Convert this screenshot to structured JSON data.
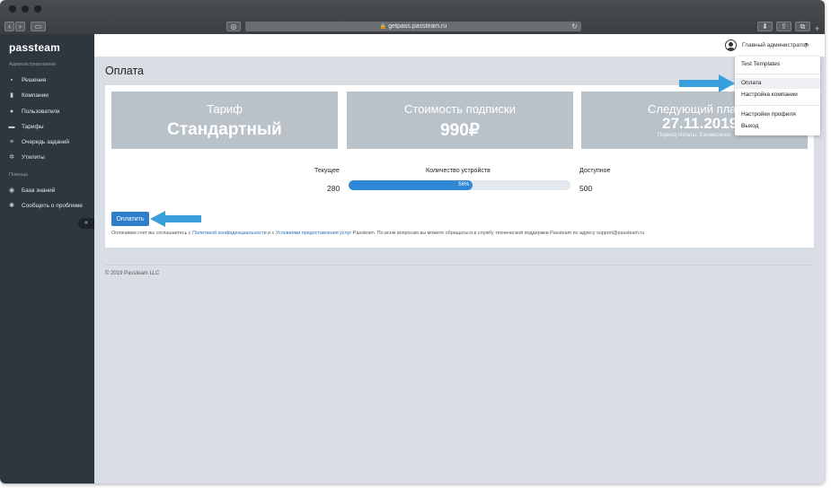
{
  "browser": {
    "url": "getpass.passteam.ru"
  },
  "sidebar": {
    "logo": "passteam",
    "admin_heading": "Администрирование",
    "items": [
      {
        "label": "Решения",
        "icon": "briefcase-icon"
      },
      {
        "label": "Компании",
        "icon": "building-icon"
      },
      {
        "label": "Пользователи",
        "icon": "users-icon"
      },
      {
        "label": "Тарифы",
        "icon": "card-icon"
      },
      {
        "label": "Очередь заданий",
        "icon": "list-icon"
      },
      {
        "label": "Утилиты",
        "icon": "gear-icon"
      }
    ],
    "help_heading": "Помощь",
    "help_items": [
      {
        "label": "База знаний",
        "icon": "lifebuoy-icon"
      },
      {
        "label": "Сообщить о проблеме",
        "icon": "bug-icon"
      }
    ],
    "collapse_label": "«"
  },
  "header": {
    "user_name": "Главный администратор"
  },
  "dropdown": {
    "items": [
      "Test Templates",
      "Оплата",
      "Настройка компании",
      "Настройки профиля",
      "Выход"
    ],
    "active": "Оплата"
  },
  "main": {
    "title": "Оплата",
    "tiles": {
      "plan": {
        "title": "Тариф",
        "value": "Стандартный"
      },
      "subscription": {
        "title": "Стоимость подписки",
        "value": "990₽"
      },
      "next_payment": {
        "title": "Следующий платеж",
        "value": "27.11.2019",
        "sub": "Период оплаты: Ежемесячно"
      }
    },
    "stats": {
      "current_label": "Текущее",
      "current_value": "280",
      "devices_label": "Количество устройств",
      "available_label": "Доступное",
      "available_value": "500",
      "progress_percent": 56,
      "progress_text": "56%"
    },
    "pay_button": "Оплатить",
    "terms": {
      "before": "Оплачивая счет вы соглашаетесь с ",
      "privacy_link": "Политикой конфиденциальности",
      "middle": " и с ",
      "terms_link": "Условиями предоставления услуг",
      "after": " Passteam. По всем вопросам вы можете обращаться в службу технической поддержки Passteam по адресу support@passteam.ru"
    },
    "copyright": "© 2019 Passteam LLC"
  },
  "colors": {
    "sidebar": "#2e3740",
    "accent": "#2e7ec9",
    "tile": "#b9c2c9",
    "annotation_arrow": "#3aa0dc"
  }
}
